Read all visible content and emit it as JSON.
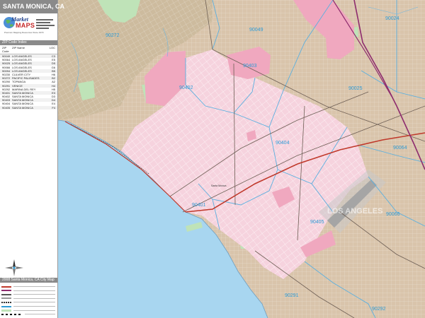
{
  "header": {
    "title": "SANTA MONICA, CA"
  },
  "brand": {
    "name_part1": "Market",
    "name_part2": "MAPS",
    "tagline": "Premium Mapping Resources Since 1979"
  },
  "zip_index": {
    "heading": "ZIP Code Index",
    "col_zip": "ZIP Code",
    "col_name": "ZIP Name",
    "col_loc": "LOC",
    "rows": [
      {
        "zip": "90049",
        "name": "LOS ANGELES",
        "loc": "C3"
      },
      {
        "zip": "90064",
        "name": "LOS ANGELES",
        "loc": "E5"
      },
      {
        "zip": "90025",
        "name": "LOS ANGELES",
        "loc": "D5"
      },
      {
        "zip": "90066",
        "name": "LOS ANGELES",
        "loc": "G6"
      },
      {
        "zip": "90094",
        "name": "LOS ANGELES",
        "loc": "B5"
      },
      {
        "zip": "90230",
        "name": "CULVER CITY",
        "loc": "H6"
      },
      {
        "zip": "90272",
        "name": "PACIFIC PALISADES",
        "loc": "B2"
      },
      {
        "zip": "90290",
        "name": "TOPANGA",
        "loc": "A2"
      },
      {
        "zip": "90291",
        "name": "VENICE",
        "loc": "H4"
      },
      {
        "zip": "90292",
        "name": "MARINA DEL REY",
        "loc": "H5"
      },
      {
        "zip": "90401",
        "name": "SANTA MONICA",
        "loc": "E3"
      },
      {
        "zip": "90402",
        "name": "SANTA MONICA",
        "loc": "D3"
      },
      {
        "zip": "90403",
        "name": "SANTA MONICA",
        "loc": "D4"
      },
      {
        "zip": "90404",
        "name": "SANTA MONICA",
        "loc": "E4"
      },
      {
        "zip": "90405",
        "name": "SANTA MONICA",
        "loc": "F4"
      }
    ]
  },
  "info": {
    "heading": "2008 Santa Monica, CA City Map"
  },
  "map": {
    "zip_labels": [
      {
        "id": "90272",
        "text": "90272"
      },
      {
        "id": "90049",
        "text": "90049"
      },
      {
        "id": "90024",
        "text": "90024"
      },
      {
        "id": "90403",
        "text": "90403"
      },
      {
        "id": "90402",
        "text": "90402"
      },
      {
        "id": "90025",
        "text": "90025"
      },
      {
        "id": "90404",
        "text": "90404"
      },
      {
        "id": "90064",
        "text": "90064"
      },
      {
        "id": "90401",
        "text": "90401"
      },
      {
        "id": "90405",
        "text": "90405"
      },
      {
        "id": "90066",
        "text": "90066"
      },
      {
        "id": "90291",
        "text": "90291"
      },
      {
        "id": "90292",
        "text": "90292"
      }
    ],
    "place_label": "Santa Monica",
    "watermark": "LOS ANGELES",
    "colors": {
      "ocean": "#a8d6f0",
      "land": "#d9c4ab",
      "santa_monica": "#f6d3de",
      "highlight": "#f0a8bf",
      "park": "#bfe3b8",
      "zip_label": "#2d9bd6",
      "freeway": "#c0392b"
    }
  }
}
